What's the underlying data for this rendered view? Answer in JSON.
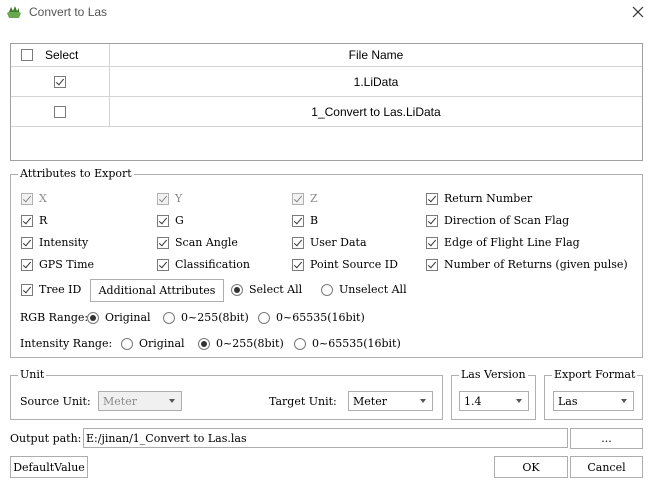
{
  "window": {
    "title": "Convert to Las",
    "app_icon": "app-icon",
    "close_icon": "close-icon"
  },
  "table": {
    "columns": [
      "Select",
      "File Name"
    ],
    "rows": [
      {
        "checked": true,
        "name": "1.LiData"
      },
      {
        "checked": false,
        "name": "1_Convert to Las.LiData"
      }
    ]
  },
  "attributes": {
    "legend": "Attributes to Export",
    "rows": [
      [
        {
          "label": "X",
          "checked": true,
          "disabled": true
        },
        {
          "label": "Y",
          "checked": true,
          "disabled": true
        },
        {
          "label": "Z",
          "checked": true,
          "disabled": true
        },
        {
          "label": "Return Number",
          "checked": true,
          "disabled": false
        }
      ],
      [
        {
          "label": "R",
          "checked": true,
          "disabled": false
        },
        {
          "label": "G",
          "checked": true,
          "disabled": false
        },
        {
          "label": "B",
          "checked": true,
          "disabled": false
        },
        {
          "label": "Direction of Scan Flag",
          "checked": true,
          "disabled": false
        }
      ],
      [
        {
          "label": "Intensity",
          "checked": true,
          "disabled": false
        },
        {
          "label": "Scan Angle",
          "checked": true,
          "disabled": false
        },
        {
          "label": "User Data",
          "checked": true,
          "disabled": false
        },
        {
          "label": "Edge of Flight Line Flag",
          "checked": true,
          "disabled": false
        }
      ],
      [
        {
          "label": "GPS Time",
          "checked": true,
          "disabled": false
        },
        {
          "label": "Classification",
          "checked": true,
          "disabled": false
        },
        {
          "label": "Point Source ID",
          "checked": true,
          "disabled": false
        },
        {
          "label": "Number of Returns (given pulse)",
          "checked": true,
          "disabled": false
        }
      ]
    ],
    "tree_id": {
      "label": "Tree ID",
      "checked": true
    },
    "additional_button": "Additional Attributes",
    "select_all": {
      "label": "Select All",
      "selected": true
    },
    "unselect_all": {
      "label": "Unselect All",
      "selected": false
    },
    "rgb_range": {
      "label": "RGB Range:",
      "options": [
        {
          "label": "Original",
          "selected": true
        },
        {
          "label": "0~255(8bit)",
          "selected": false
        },
        {
          "label": "0~65535(16bit)",
          "selected": false
        }
      ]
    },
    "intensity_range": {
      "label": "Intensity Range:",
      "options": [
        {
          "label": "Original",
          "selected": false
        },
        {
          "label": "0~255(8bit)",
          "selected": true
        },
        {
          "label": "0~65535(16bit)",
          "selected": false
        }
      ]
    }
  },
  "unit": {
    "legend": "Unit",
    "source_label": "Source Unit:",
    "source_value": "Meter",
    "target_label": "Target Unit:",
    "target_value": "Meter"
  },
  "las_version": {
    "legend": "Las Version",
    "value": "1.4"
  },
  "export_format": {
    "legend": "Export Format",
    "value": "Las"
  },
  "output": {
    "label": "Output path:",
    "value": "E:/jinan/1_Convert to Las.las",
    "browse": "..."
  },
  "buttons": {
    "default": "DefaultValue",
    "ok": "OK",
    "cancel": "Cancel"
  }
}
